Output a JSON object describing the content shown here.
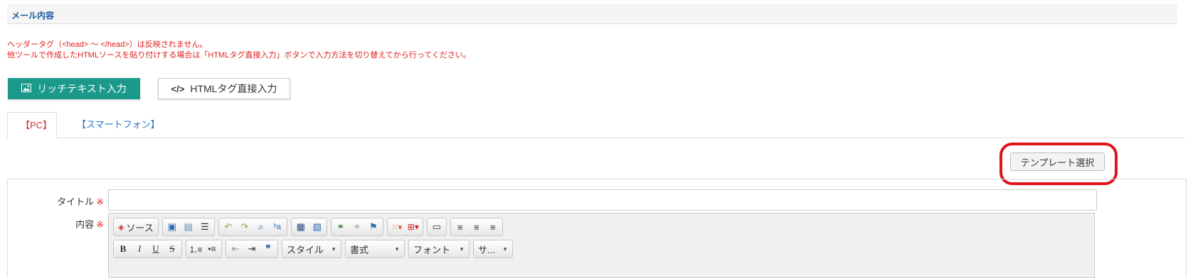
{
  "section": {
    "title": "メール内容"
  },
  "notice": {
    "line1": "ヘッダータグ（<head> ～ </head>）は反映されません。",
    "line2": "他ツールで作成したHTMLソースを貼り付けする場合は「HTMLタグ直接入力」ボタンで入力方法を切り替えてから行ってください。"
  },
  "mode_buttons": {
    "rich_text": "リッチテキスト入力",
    "html_direct": "HTMLタグ直接入力"
  },
  "tabs": [
    {
      "label": "【PC】",
      "active": true
    },
    {
      "label": "【スマートフォン】",
      "active": false
    }
  ],
  "template_button": "テンプレート選択",
  "form": {
    "title_label": "タイトル",
    "content_label": "内容",
    "required_mark": "※",
    "title_value": ""
  },
  "toolbar": {
    "source_label": "ソース",
    "style_combo": "スタイル",
    "format_combo": "書式",
    "font_combo": "フォント",
    "size_combo": "サ..."
  },
  "colors": {
    "accent": "#1b9a8c",
    "link": "#2a7ac0",
    "warning": "#e02020",
    "highlight": "#e0141c"
  }
}
